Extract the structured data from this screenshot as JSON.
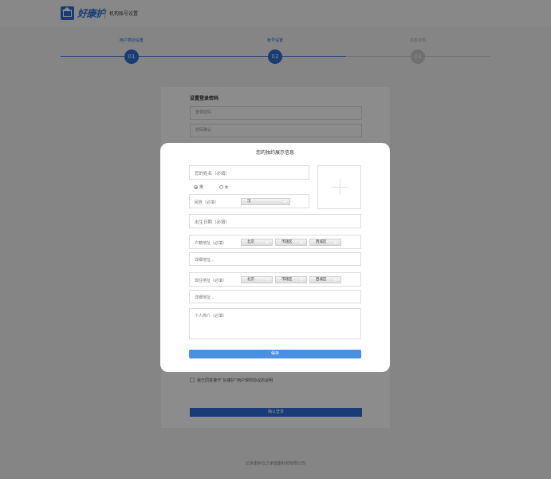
{
  "header": {
    "logo_text": "好康护",
    "title": "机构账号设置"
  },
  "steps": [
    {
      "label": "用户类别设置",
      "number": "01",
      "state": "done"
    },
    {
      "label": "账号设置",
      "number": "02",
      "state": "active"
    },
    {
      "label": "完善资料",
      "number": "03",
      "state": "pending"
    }
  ],
  "page": {
    "section_title": "设置登录密码",
    "password_placeholder": "登录密码",
    "password_confirm_placeholder": "密码确认",
    "agree_text": "我已同意遵守“好康护”用户规则协议的说明",
    "confirm_button": "确认登录"
  },
  "footer": {
    "text": "北京康护云之家健康科技有限公司"
  },
  "modal": {
    "title": "您的独约展示信息",
    "name_placeholder": "您的姓名（必填）",
    "gender_options": [
      {
        "label": "男",
        "checked": true
      },
      {
        "label": "女",
        "checked": false
      }
    ],
    "ethnicity": {
      "label": "民族（必填）",
      "value": "汉"
    },
    "birthday_placeholder": "出生日期（必填）",
    "household": {
      "label": "户籍地址（必填）",
      "province": "北京",
      "city": "市辖区",
      "district": "西城区",
      "detail_placeholder": "详细地址..."
    },
    "current": {
      "label": "现住地址（必填）",
      "province": "北京",
      "city": "市辖区",
      "district": "西城区",
      "detail_placeholder": "详细地址..."
    },
    "intro_placeholder": "个人简介（必填）",
    "save_button": "保存"
  }
}
